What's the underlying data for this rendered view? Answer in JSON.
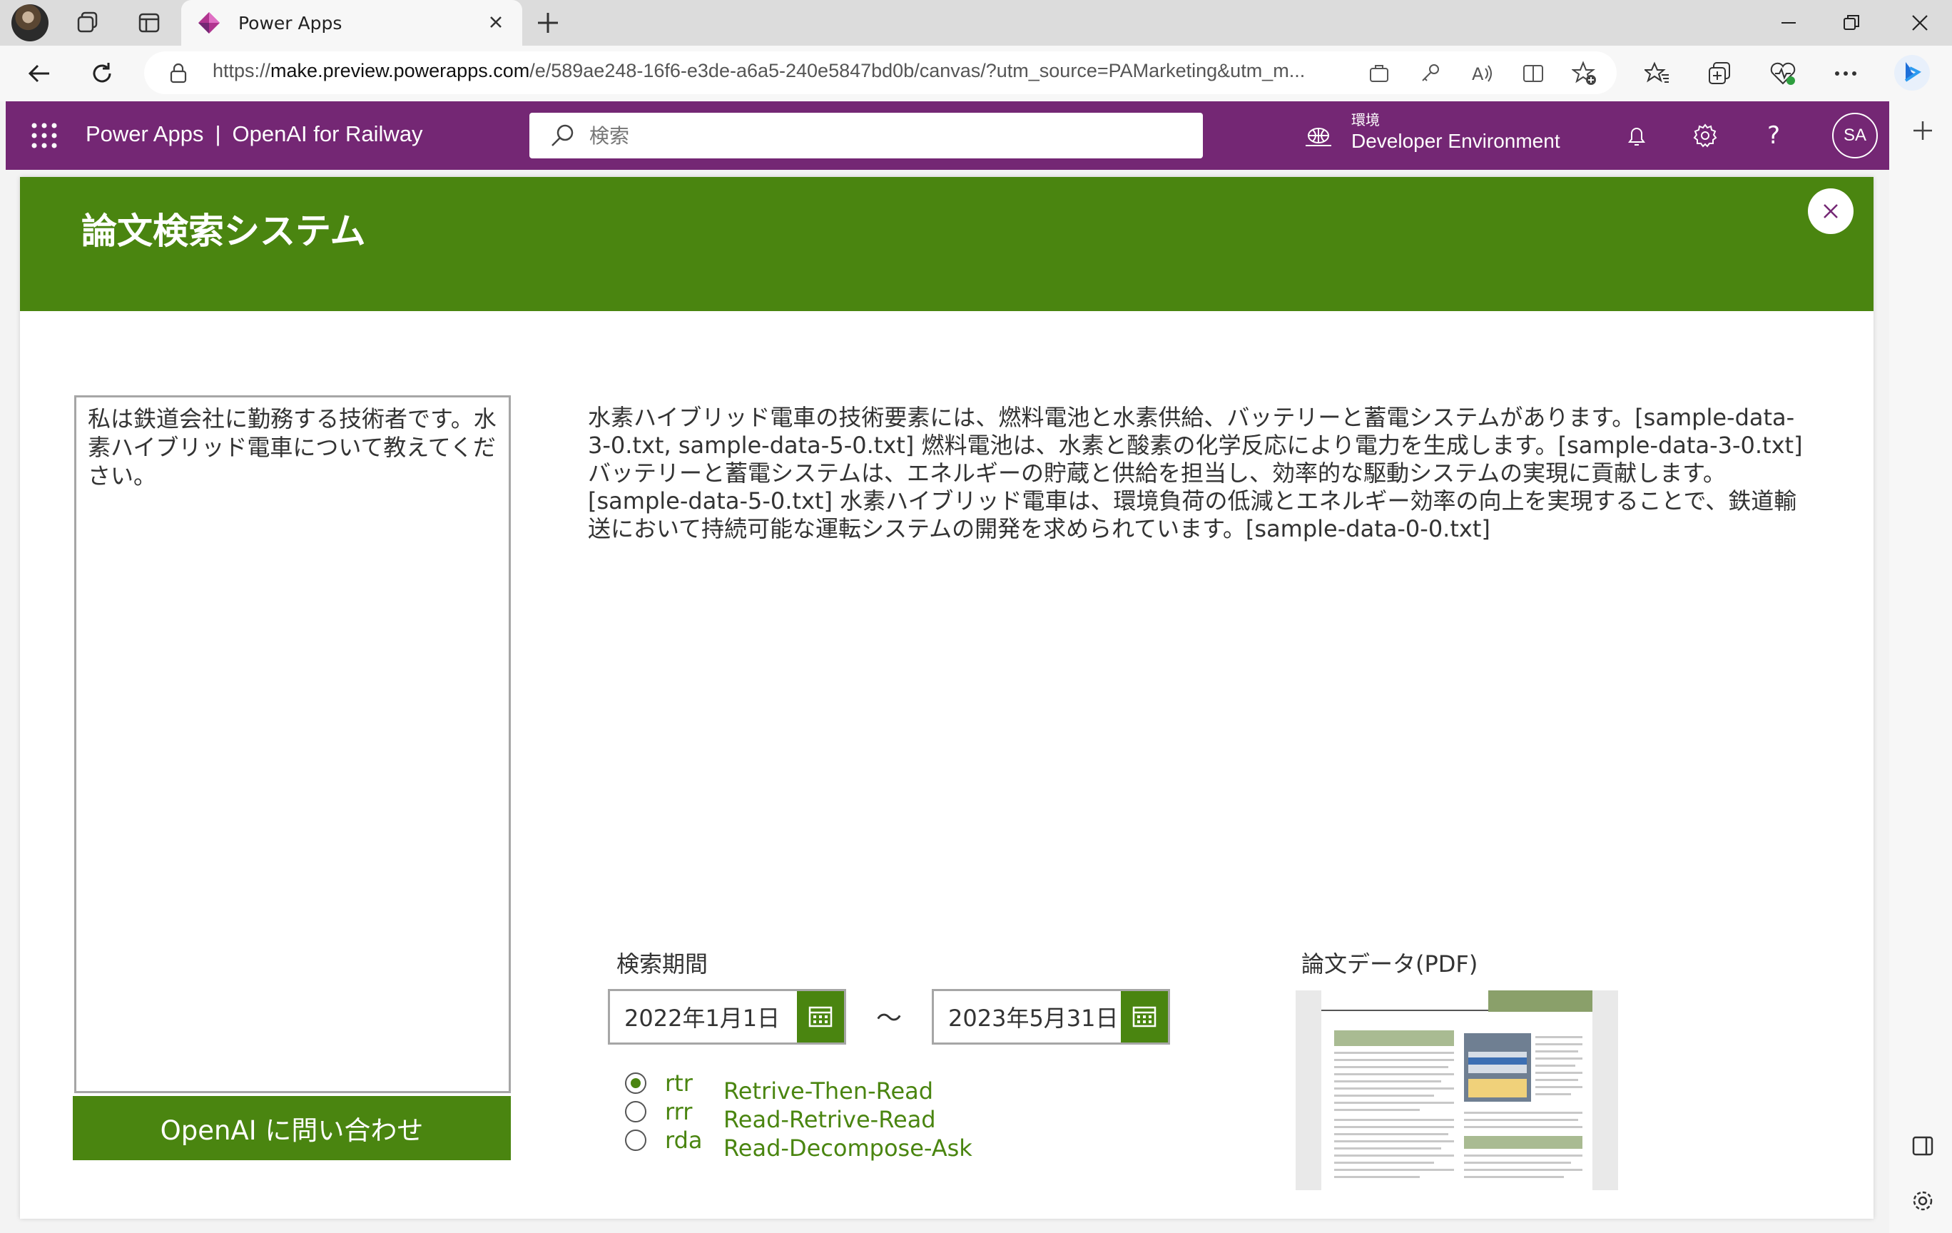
{
  "browser": {
    "tab_title": "Power Apps",
    "url_prefix": "https://",
    "url_host": "make.preview.powerapps.com",
    "url_rest": "/e/589ae248-16f6-e3de-a6a5-240e5847bd0b/canvas/?utm_source=PAMarketing&utm_m..."
  },
  "header": {
    "product": "Power Apps",
    "separator": "|",
    "app_name": "OpenAI for Railway",
    "search_placeholder": "検索",
    "env_label": "環境",
    "env_name": "Developer Environment",
    "user_initials": "SA"
  },
  "app": {
    "title": "論文検索システム",
    "question": "私は鉄道会社に勤務する技術者です。水素ハイブリッド電車について教えてください。",
    "ask_button": "OpenAI に問い合わせ",
    "answer": "水素ハイブリッド電車の技術要素には、燃料電池と水素供給、バッテリーと蓄電システムがあります。[sample-data-3-0.txt, sample-data-5-0.txt] 燃料電池は、水素と酸素の化学反応により電力を生成します。[sample-data-3-0.txt] バッテリーと蓄電システムは、エネルギーの貯蔵と供給を担当し、効率的な駆動システムの実現に貢献します。[sample-data-5-0.txt] 水素ハイブリッド電車は、環境負荷の低減とエネルギー効率の向上を実現することで、鉄道輸送において持続可能な運転システムの開発を求められています。[sample-data-0-0.txt]",
    "period_label": "検索期間",
    "date_from": "2022年1月1日",
    "date_to": "2023年5月31日",
    "tilde": "～",
    "modes": [
      {
        "key": "rtr",
        "desc": "Retrive-Then-Read",
        "selected": true
      },
      {
        "key": "rrr",
        "desc": "Read-Retrive-Read",
        "selected": false
      },
      {
        "key": "rda",
        "desc": "Read-Decompose-Ask",
        "selected": false
      }
    ],
    "pdf_label": "論文データ(PDF)"
  },
  "colors": {
    "powerapps_purple": "#742774",
    "app_green": "#4a8510"
  }
}
